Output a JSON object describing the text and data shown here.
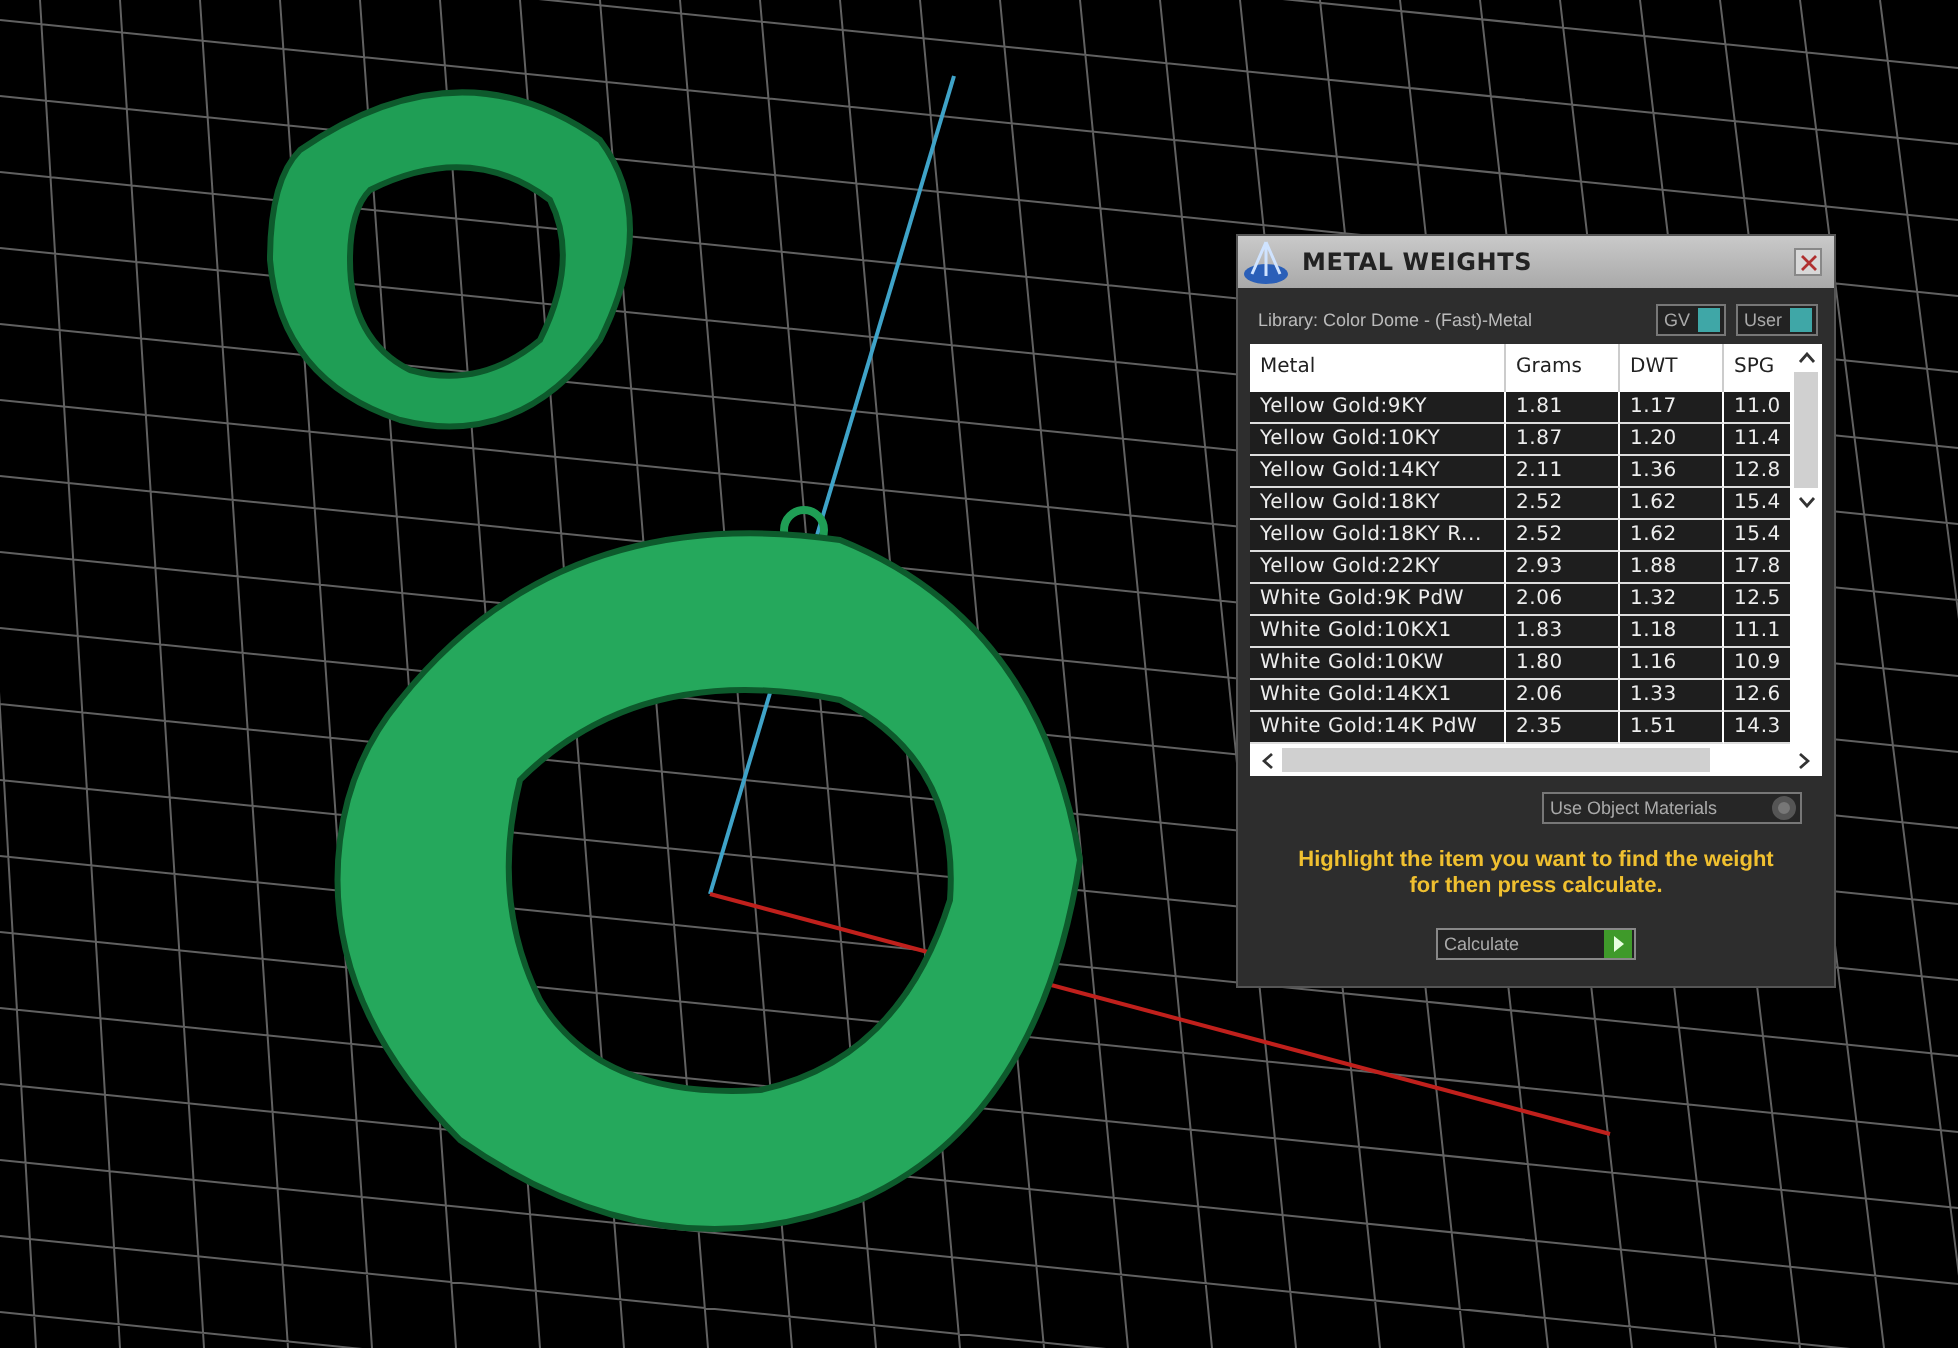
{
  "panel": {
    "title": "METAL WEIGHTS",
    "library": "Library: Color Dome - (Fast)-Metal",
    "toggles": [
      {
        "label": "GV",
        "on": true
      },
      {
        "label": "User",
        "on": true
      }
    ],
    "table": {
      "columns": [
        "Metal",
        "Grams",
        "DWT",
        "SPG"
      ],
      "rows": [
        [
          "Yellow Gold:9KY",
          "1.81",
          "1.17",
          "11.0"
        ],
        [
          "Yellow Gold:10KY",
          "1.87",
          "1.20",
          "11.4"
        ],
        [
          "Yellow Gold:14KY",
          "2.11",
          "1.36",
          "12.8"
        ],
        [
          "Yellow Gold:18KY",
          "2.52",
          "1.62",
          "15.4"
        ],
        [
          "Yellow Gold:18KY R...",
          "2.52",
          "1.62",
          "15.4"
        ],
        [
          "Yellow Gold:22KY",
          "2.93",
          "1.88",
          "17.8"
        ],
        [
          "White Gold:9K PdW",
          "2.06",
          "1.32",
          "12.5"
        ],
        [
          "White Gold:10KX1",
          "1.83",
          "1.18",
          "11.1"
        ],
        [
          "White Gold:10KW",
          "1.80",
          "1.16",
          "10.9"
        ],
        [
          "White Gold:14KX1",
          "2.06",
          "1.33",
          "12.6"
        ],
        [
          "White Gold:14K PdW",
          "2.35",
          "1.51",
          "14.3"
        ]
      ]
    },
    "use_object_materials": {
      "label": "Use Object Materials",
      "on": false
    },
    "hint": "Highlight the item you want to find the weight for then press calculate.",
    "calculate_button": "Calculate"
  }
}
